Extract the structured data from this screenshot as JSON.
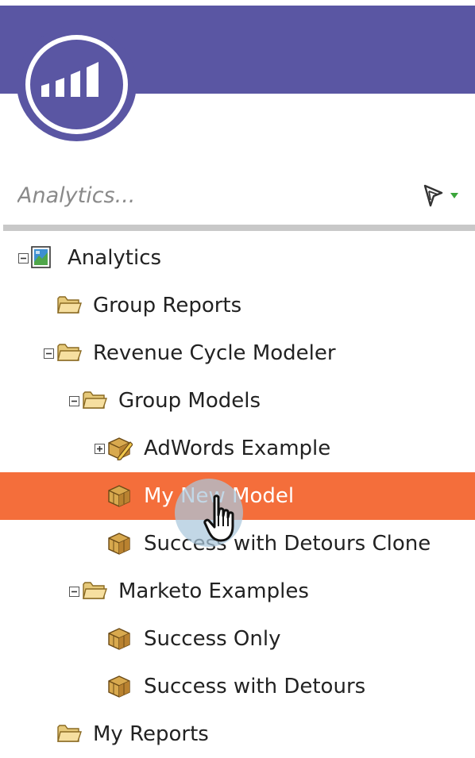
{
  "app": {
    "brand_color": "#5a56a3",
    "accent_color": "#f46e3b"
  },
  "search": {
    "placeholder": "Analytics...",
    "value": "",
    "filter_icon": "filter-funnel-icon"
  },
  "tree": {
    "nodes": [
      {
        "label": "Analytics",
        "icon": "analytics-icon",
        "toggle": "collapse",
        "depth": 0
      },
      {
        "label": "Group Reports",
        "icon": "folder-icon",
        "toggle": "",
        "depth": 1
      },
      {
        "label": "Revenue Cycle Modeler",
        "icon": "folder-icon",
        "toggle": "collapse",
        "depth": 1
      },
      {
        "label": "Group Models",
        "icon": "folder-icon",
        "toggle": "collapse",
        "depth": 2
      },
      {
        "label": "AdWords Example",
        "icon": "model-edit-icon",
        "toggle": "expand",
        "depth": 3
      },
      {
        "label": "My New Model",
        "icon": "model-cube-icon",
        "toggle": "",
        "depth": 3,
        "selected": true
      },
      {
        "label": "Success with Detours Clone",
        "icon": "model-cube-icon",
        "toggle": "",
        "depth": 3
      },
      {
        "label": "Marketo Examples",
        "icon": "folder-icon",
        "toggle": "collapse",
        "depth": 2
      },
      {
        "label": "Success Only",
        "icon": "model-cube-icon",
        "toggle": "",
        "depth": 3
      },
      {
        "label": "Success with Detours",
        "icon": "model-cube-icon",
        "toggle": "",
        "depth": 3
      },
      {
        "label": "My Reports",
        "icon": "folder-icon",
        "toggle": "",
        "depth": 1
      }
    ]
  },
  "cursor": {
    "icon": "hand-pointer-icon"
  }
}
